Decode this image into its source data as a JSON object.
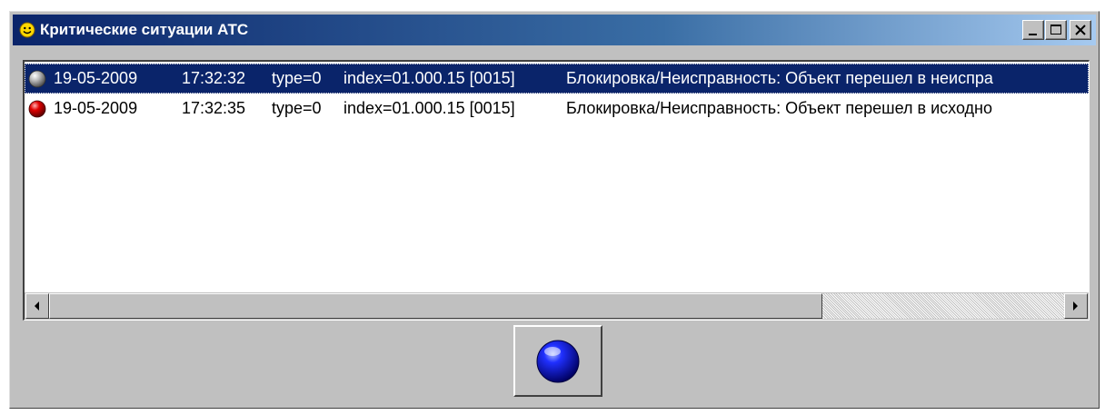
{
  "window": {
    "title": "Критические ситуации АТС",
    "title_icon": "smiley-icon",
    "controls": {
      "minimize": "minimize-icon",
      "maximize": "maximize-icon",
      "close": "close-icon"
    }
  },
  "events": [
    {
      "status": "gray",
      "date": "19-05-2009",
      "time": "17:32:32",
      "type": "type=0",
      "index": "index=01.000.15 [0015]",
      "message": "Блокировка/Неисправность: Объект перешел в неиспра",
      "selected": true
    },
    {
      "status": "red",
      "date": "19-05-2009",
      "time": "17:32:35",
      "type": "type=0",
      "index": "index=01.000.15 [0015]",
      "message": "Блокировка/Неисправность: Объект перешел в исходно",
      "selected": false
    }
  ],
  "scrollbar": {
    "position": 0.0,
    "visible_fraction": 0.75
  },
  "action_button": {
    "icon": "blue-ball-icon",
    "color": "#0000cc"
  },
  "colors": {
    "selection": "#0a246a",
    "titlebar": "#0a246a",
    "face": "#c0c0c0"
  }
}
